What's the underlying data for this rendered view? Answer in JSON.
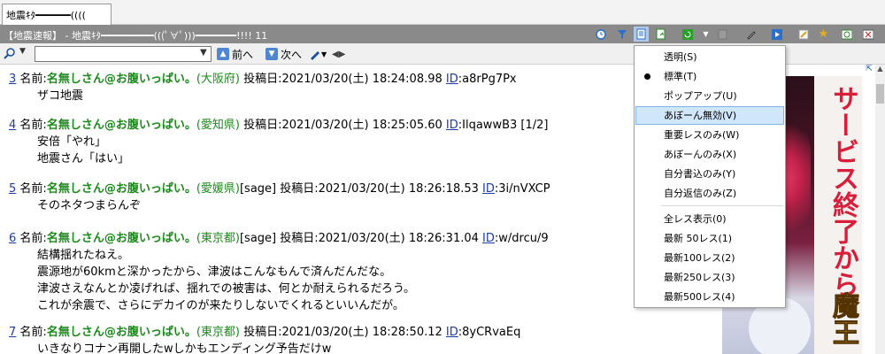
{
  "tab": {
    "label": "地震ｷﾀ━━━━━━(((("
  },
  "titlebar": {
    "title": "【地震速報】 - 地震ｷﾀ━━━━━━━━━(((ﾟ∀ﾟ)))━━━━━━━!!!! 11"
  },
  "search": {
    "value": "",
    "prev_label": "前へ",
    "next_label": "次へ"
  },
  "posts": [
    {
      "num": "3",
      "name_prefix": "名前:",
      "name": "名無しさん@お腹いっぱい。",
      "loc": "(大阪府)",
      "mail": "",
      "date_label": " 投稿日:2021/03/20(土) 18:24:08.98 ",
      "id_label": "ID",
      "id_value": ":a8rPg7Px",
      "extra": "",
      "lines": [
        "ザコ地震"
      ]
    },
    {
      "num": "4",
      "name_prefix": "名前:",
      "name": "名無しさん@お腹いっぱい。",
      "loc": "(愛知県)",
      "mail": "",
      "date_label": " 投稿日:2021/03/20(土) 18:25:05.60 ",
      "id_label": "ID",
      "id_value": ":IlqawwB3",
      "extra": " [1/2]",
      "lines": [
        "安倍「やれ」",
        "地震さん「はい」"
      ]
    },
    {
      "num": "5",
      "name_prefix": "名前:",
      "name": "名無しさん@お腹いっぱい。",
      "loc": "(愛媛県)",
      "mail": "[sage]",
      "date_label": " 投稿日:2021/03/20(土) 18:26:18.53 ",
      "id_label": "ID",
      "id_value": ":3i/nVXCP",
      "extra": "",
      "lines": [
        "そのネタつまらんぞ"
      ]
    },
    {
      "num": "6",
      "name_prefix": "名前:",
      "name": "名無しさん@お腹いっぱい。",
      "loc": "(東京都)",
      "mail": "[sage]",
      "date_label": " 投稿日:2021/03/20(土) 18:26:31.04 ",
      "id_label": "ID",
      "id_value": ":w/drcu/9",
      "extra": "",
      "lines": [
        "結構揺れたねえ。",
        "震源地が60kmと深かったから、津波はこんなもんで済んだんだな。",
        "津波さえなんとか凌げれば、揺れでの被害は、何とか耐えられるだろう。",
        "これが余震で、さらにデカイのが来たりしないでくれるといいんだが。"
      ]
    },
    {
      "num": "7",
      "name_prefix": "名前:",
      "name": "名無しさん@お腹いっぱい。",
      "loc": "(東京都)",
      "mail": "",
      "date_label": " 投稿日:2021/03/20(土) 18:28:50.12 ",
      "id_label": "ID",
      "id_value": ":8yCRvaEq",
      "extra": "",
      "lines": [
        "いきなりコナン再開したwしかもエンディング予告だけw"
      ]
    }
  ],
  "menu": {
    "items": [
      {
        "label": "透明(S)",
        "selected": false,
        "highlighted": false
      },
      {
        "label": "標準(T)",
        "selected": true,
        "highlighted": false
      },
      {
        "label": "ポップアップ(U)",
        "selected": false,
        "highlighted": false
      },
      {
        "label": "あぼーん無効(V)",
        "selected": false,
        "highlighted": true
      },
      {
        "label": "重要レスのみ(W)",
        "selected": false,
        "highlighted": false
      },
      {
        "label": "あぼーんのみ(X)",
        "selected": false,
        "highlighted": false
      },
      {
        "label": "自分書込のみ(Y)",
        "selected": false,
        "highlighted": false
      },
      {
        "label": "自分返信のみ(Z)",
        "selected": false,
        "highlighted": false
      },
      {
        "label": "全レス表示(0)",
        "selected": false,
        "highlighted": false
      },
      {
        "label": "最新 50レス(1)",
        "selected": false,
        "highlighted": false
      },
      {
        "label": "最新100レス(2)",
        "selected": false,
        "highlighted": false
      },
      {
        "label": "最新250レス(3)",
        "selected": false,
        "highlighted": false
      },
      {
        "label": "最新500レス(4)",
        "selected": false,
        "highlighted": false
      }
    ]
  },
  "ad": {
    "text_top": "サービス終了から",
    "text_bottom": "魔王"
  },
  "icons": [
    "clock-icon",
    "filter-icon",
    "document-icon",
    "document-arrow-icon",
    "refresh-icon",
    "dropdown-icon",
    "box-icon",
    "pen-icon",
    "play-icon",
    "note-icon",
    "star-icon",
    "window-refresh-icon",
    "close-icon",
    "search-icon",
    "arrow-up-icon",
    "arrow-down-icon",
    "pen-icon",
    "nav-arrows-icon"
  ]
}
